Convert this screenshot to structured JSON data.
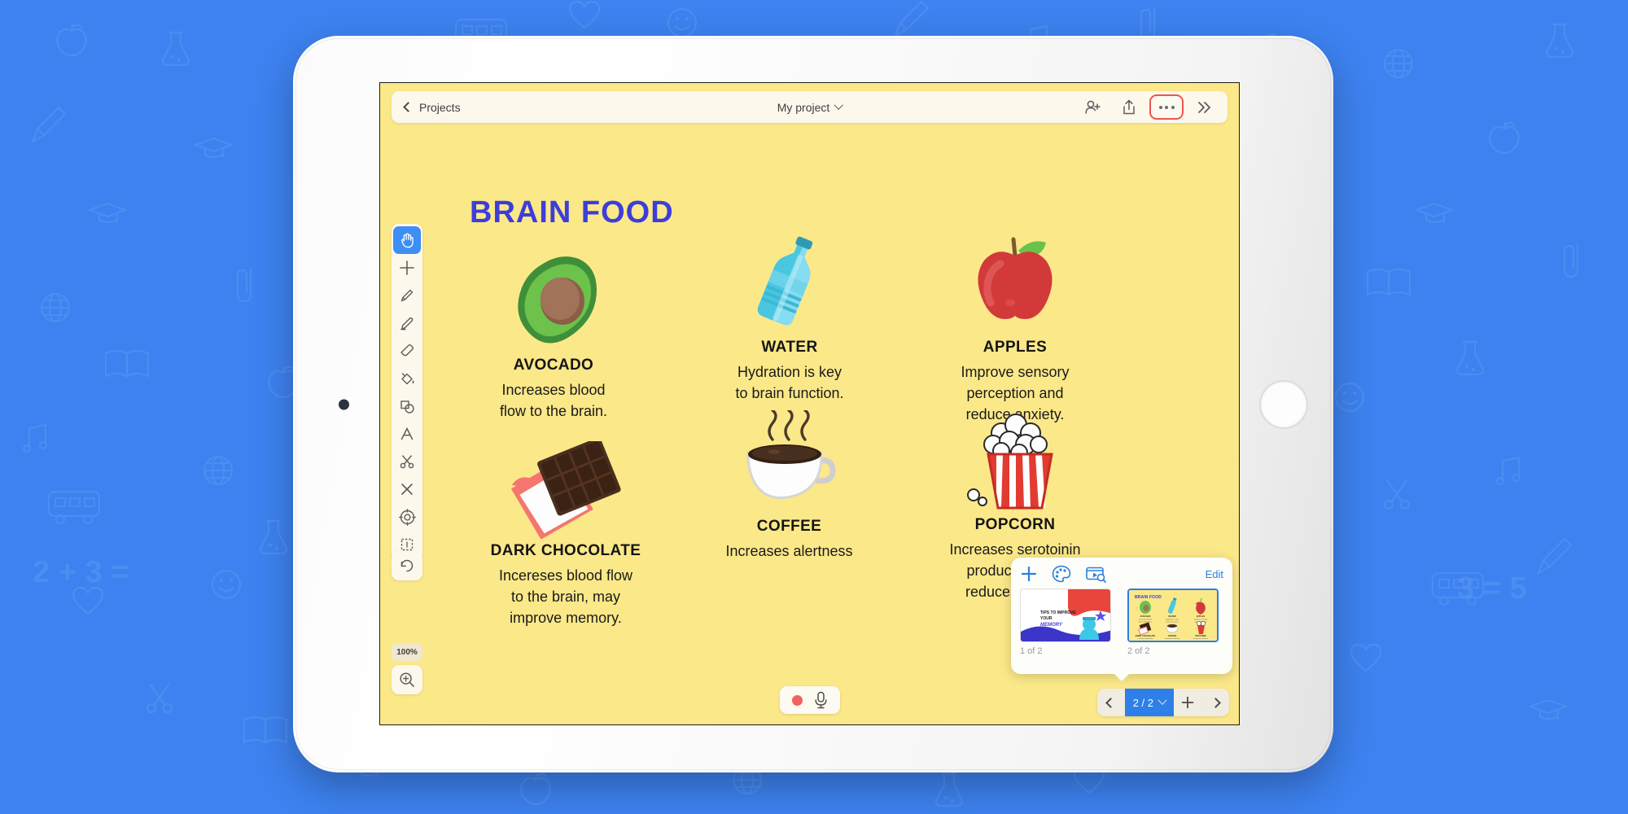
{
  "app": {
    "topbar": {
      "back_label": "Projects",
      "project_title": "My project",
      "icons": {
        "back_chevron": "chevron-left-icon",
        "title_caret": "chevron-down-icon",
        "add_person": "add-person-icon",
        "share": "share-icon",
        "more": "more-options-icon",
        "expand": "chevrons-right-icon"
      },
      "more_highlight_color": "#f0534f"
    },
    "toolbar": {
      "active_tool": "hand-tool",
      "accent_color": "#3d8ef5",
      "tools": [
        {
          "name": "hand-tool",
          "label": "Hand"
        },
        {
          "name": "add-tool",
          "label": "Add"
        },
        {
          "name": "pencil-tool",
          "label": "Pencil"
        },
        {
          "name": "marker-tool",
          "label": "Marker"
        },
        {
          "name": "eraser-tool",
          "label": "Eraser"
        },
        {
          "name": "fill-tool",
          "label": "Fill"
        },
        {
          "name": "shapes-tool",
          "label": "Shapes"
        },
        {
          "name": "text-tool",
          "label": "Text"
        },
        {
          "name": "scissors-tool",
          "label": "Cut"
        },
        {
          "name": "close-tool",
          "label": "Delete"
        },
        {
          "name": "target-tool",
          "label": "Target"
        },
        {
          "name": "select-tool",
          "label": "Select"
        }
      ],
      "undo_label": "Undo",
      "zoom_level": "100%",
      "zoom_in_label": "Zoom in"
    },
    "canvas": {
      "title": "BRAIN FOOD",
      "title_color": "#3d3ddb",
      "background_color": "#fbe889",
      "cards": [
        {
          "art": "avocado-illustration",
          "caption": "AVOCADO",
          "description": "Increases blood\nflow to the brain."
        },
        {
          "art": "water-bottle-illustration",
          "caption": "WATER",
          "description": "Hydration is key\nto brain function."
        },
        {
          "art": "apple-illustration",
          "caption": "APPLES",
          "description": "Improve sensory\nperception and\nreduce anxiety."
        },
        {
          "art": "chocolate-illustration",
          "caption": "DARK CHOCOLATE",
          "description": "Incereses blood flow\nto the brain, may\nimprove memory."
        },
        {
          "art": "coffee-illustration",
          "caption": "COFFEE",
          "description": "Increases alertness"
        },
        {
          "art": "popcorn-illustration",
          "caption": "POPCORN",
          "description": "Increases serotoinin\nproduction and\nreduces stress."
        }
      ]
    },
    "recordbar": {
      "record_label": "Record",
      "mic_label": "Microphone"
    },
    "slide_panel": {
      "edit_label": "Edit",
      "tools": [
        {
          "name": "add-slide-icon",
          "label": "Add slide"
        },
        {
          "name": "palette-icon",
          "label": "Theme"
        },
        {
          "name": "media-search-icon",
          "label": "Media"
        }
      ],
      "slides": [
        {
          "label": "1 of 2",
          "title": "TIPS TO IMPROVE YOUR MEMORY",
          "selected": false
        },
        {
          "label": "2 of 2",
          "title": "BRAIN FOOD",
          "selected": true
        }
      ]
    },
    "page_nav": {
      "prev_label": "Previous page",
      "count": "2 / 2",
      "add_label": "Add page",
      "next_label": "Next page",
      "active_color": "#2f7fe8"
    }
  }
}
